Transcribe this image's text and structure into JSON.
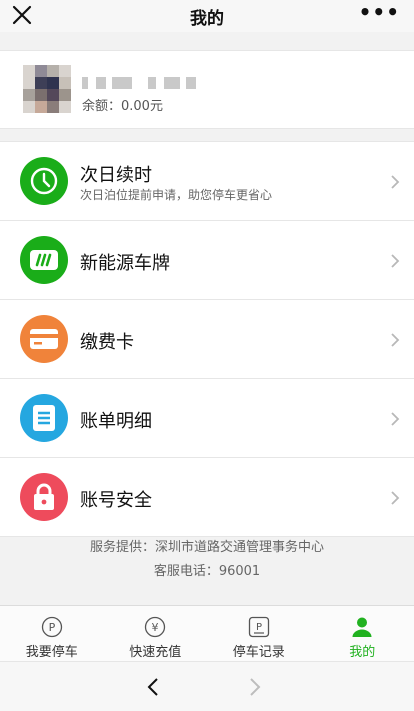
{
  "header": {
    "title": "我的",
    "close_icon": "close-icon",
    "more_icon": "more-dots-icon"
  },
  "profile": {
    "balance": "余额：0.00元"
  },
  "menu": [
    {
      "title": "次日续时",
      "subtitle": "次日泊位提前申请，助您停车更省心",
      "icon": "clock-icon",
      "color": "#1aad19"
    },
    {
      "title": "新能源车牌",
      "subtitle": "",
      "icon": "new-energy-plate-icon",
      "color": "#1aad19"
    },
    {
      "title": "缴费卡",
      "subtitle": "",
      "icon": "card-icon",
      "color": "#f0833a"
    },
    {
      "title": "账单明细",
      "subtitle": "",
      "icon": "bill-list-icon",
      "color": "#25a7e0"
    },
    {
      "title": "账号安全",
      "subtitle": "",
      "icon": "lock-icon",
      "color": "#ee4b5c"
    }
  ],
  "footer": {
    "provider": "服务提供：深圳市道路交通管理事务中心",
    "hotline": "客服电话：96001"
  },
  "tabs": [
    {
      "label": "我要停车",
      "icon": "parking-circle-icon",
      "active": false
    },
    {
      "label": "快速充值",
      "icon": "yen-circle-icon",
      "active": false
    },
    {
      "label": "停车记录",
      "icon": "parking-square-icon",
      "active": false
    },
    {
      "label": "我的",
      "icon": "person-icon",
      "active": true
    }
  ],
  "colors": {
    "accent": "#1aad19",
    "tab_active": "#21b120"
  }
}
